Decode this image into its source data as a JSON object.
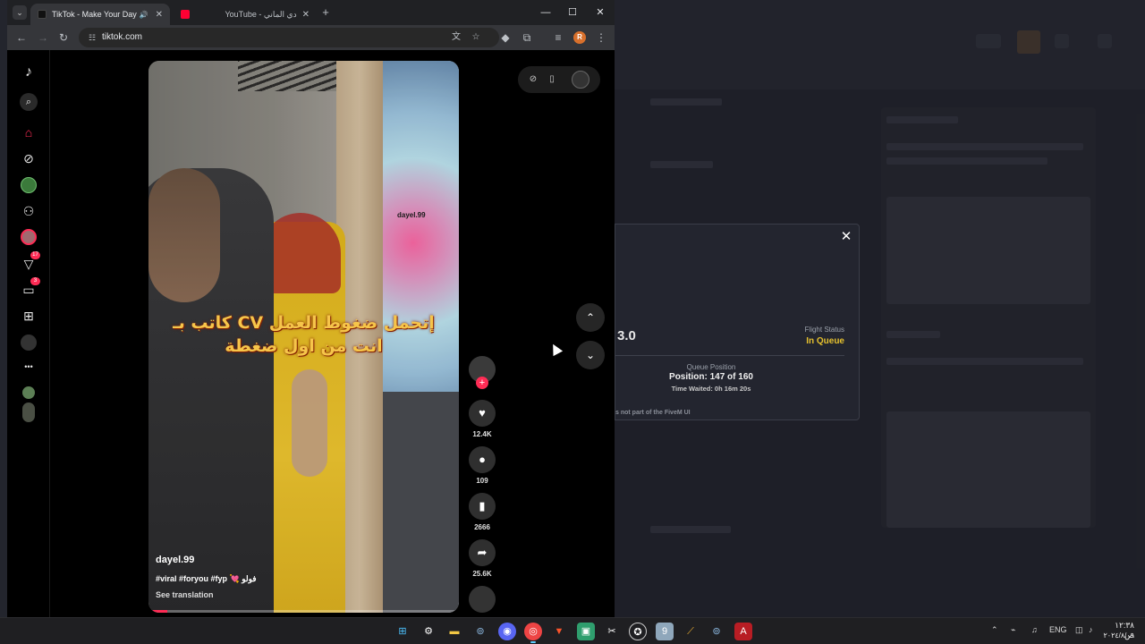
{
  "browser": {
    "tabs": [
      {
        "title": "TikTok - Make Your Day",
        "active": true,
        "audio": "🔊"
      },
      {
        "title": "YouTube - دي الماني",
        "active": false
      }
    ],
    "url": "tiktok.com",
    "profile_initial": "R"
  },
  "tiktok": {
    "sidebar_badges": {
      "activity": "17",
      "messages": "3"
    },
    "nav_more": "•••",
    "video": {
      "watermark": "dayel.99",
      "caption_line1": "كاتب بـ CV إتحمل ضغوط العمل",
      "caption_line2": "انت من اول ضغطة",
      "username": "dayel.99",
      "tags": "#viral #foryou #fyp 💘 فولو",
      "see_translation": "See translation",
      "progress": 0.06
    },
    "actions": {
      "likes": "12.4K",
      "comments": "109",
      "saves": "2666",
      "shares": "25.6K"
    }
  },
  "fivem_modal": {
    "version_text": "3.0",
    "flight_status_label": "Flight Status",
    "flight_status_value": "In Queue",
    "queue_label": "Queue Position",
    "queue_position": "Position: 147 of 160",
    "time_waited": "Time Waited: 0h 16m 20s",
    "note": "s not part of the FiveM UI"
  },
  "taskbar": {
    "language": "ENG",
    "time": "١٢:٣٨ ص",
    "date": "٢٠٢٤/٨/٠٩"
  },
  "colors": {
    "tiktok_red": "#fe2c55",
    "queue_status": "#e6c12e",
    "caption": "#f6c54a"
  }
}
